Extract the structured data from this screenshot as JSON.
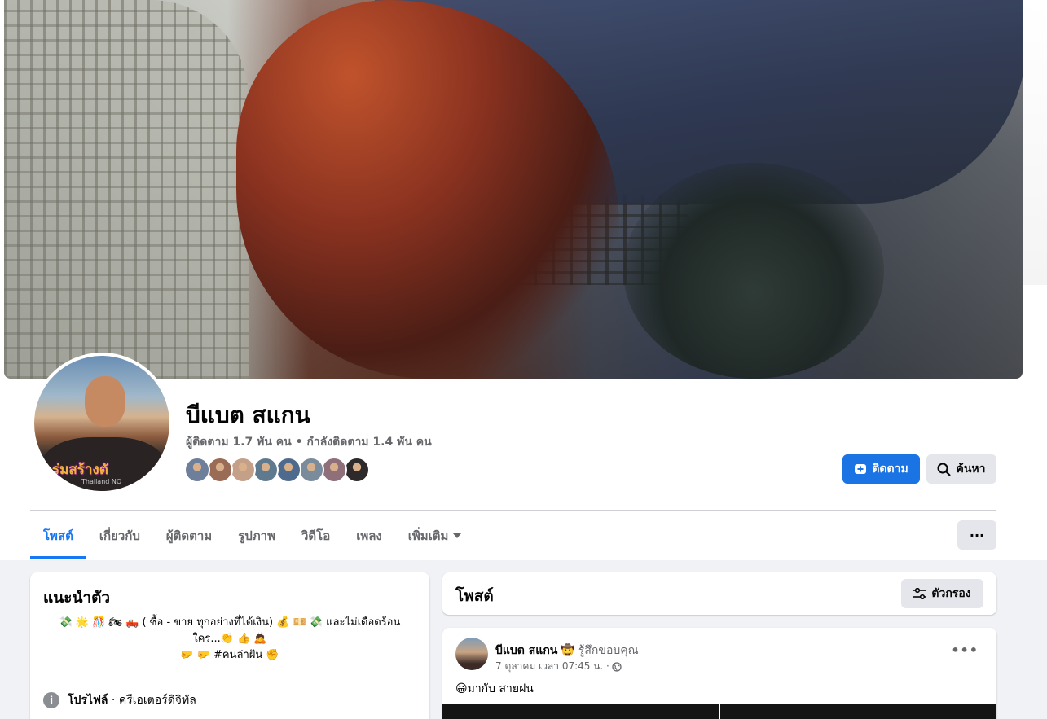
{
  "profile": {
    "name": "บีแบต สแกน",
    "stats": "ผู้ติดตาม 1.7 พัน คน • กำลังติดตาม 1.4 พัน คน",
    "avatar_brand": "ร่มสร้างตั",
    "avatar_brand_sub": "Thailand NO",
    "friend_colors": [
      "#6d7f9a",
      "#9a6b55",
      "#c4a089",
      "#5f7a8e",
      "#4e6a8c",
      "#7a8b9c",
      "#8e6f7a",
      "#2e2a2c"
    ]
  },
  "actions": {
    "follow_label": "ติดตาม",
    "search_label": "ค้นหา",
    "more_label": "···"
  },
  "tabs": [
    {
      "label": "โพสต์",
      "active": true
    },
    {
      "label": "เกี่ยวกับ"
    },
    {
      "label": "ผู้ติดตาม"
    },
    {
      "label": "รูปภาพ"
    },
    {
      "label": "วิดีโอ"
    },
    {
      "label": "เพลง"
    },
    {
      "label": "เพิ่มเติม"
    }
  ],
  "intro": {
    "title": "แนะนำตัว",
    "bio_line1": "💸 🌟 🎊 🏍 🛻 ( ซื้อ - ขาย ทุกอย่างที่ได้เงิน) 💰 💴 💸 และไม่เดือดร้อน",
    "bio_line2": "ใคร...👏 👍 🙇",
    "bio_line3": "🤛 🤛 #คนล่าฝัน ✊",
    "profile_label": "โปรไฟล์",
    "profile_category": " · ครีเอเตอร์ดิจิทัล"
  },
  "posts_section": {
    "title": "โพสต์",
    "filter_label": "ตัวกรอง"
  },
  "post": {
    "author": "บีแบต สแกน",
    "feeling_emoji": "🤠",
    "feeling": "รู้สึกขอบคุณ",
    "time": "7 ตุลาคม เวลา 07:45 น. ·",
    "text": "😀มากับ สายฝน"
  },
  "colors": {
    "accent": "#1877f2",
    "button_blue": "#1b74e4",
    "secondary_text": "#65676b",
    "button_grey": "#e4e6eb",
    "page_bg": "#f0f2f5"
  }
}
